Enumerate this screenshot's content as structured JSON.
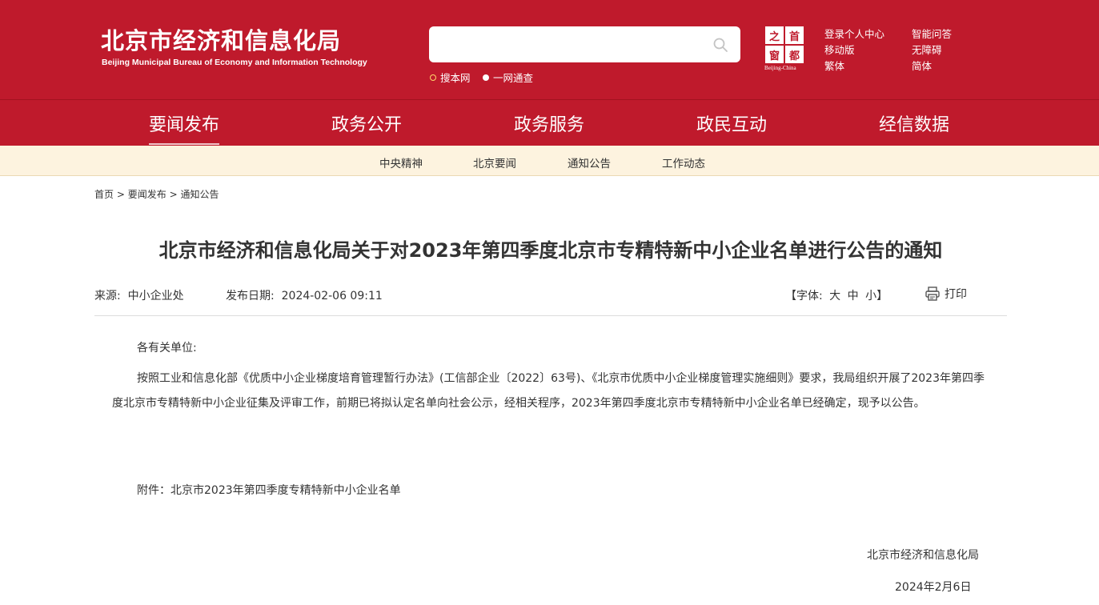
{
  "header": {
    "logo_cn": "北京市经济和信息化局",
    "logo_en": "Beijing Municipal Bureau of Economy and Information Technology",
    "search": {
      "value": "",
      "placeholder": ""
    },
    "scopes": [
      "搜本网",
      "一网通查"
    ],
    "seal_chars": [
      "之",
      "首",
      "窗",
      "都"
    ],
    "seal_en": "Beijing-China",
    "top_links": [
      "登录个人中心",
      "智能问答",
      "移动版",
      "无障碍",
      "繁体",
      "简体"
    ]
  },
  "nav": {
    "main": [
      "要闻发布",
      "政务公开",
      "政务服务",
      "政民互动",
      "经信数据"
    ],
    "active_index": 0,
    "sub": [
      "中央精神",
      "北京要闻",
      "通知公告",
      "工作动态"
    ]
  },
  "breadcrumb": [
    "首页",
    "要闻发布",
    "通知公告"
  ],
  "breadcrumb_sep": ">",
  "article": {
    "title": "北京市经济和信息化局关于对2023年第四季度北京市专精特新中小企业名单进行公告的通知",
    "source_label": "来源:",
    "source": "中小企业处",
    "date_label": "发布日期:",
    "date": "2024-02-06 09:11",
    "font_label": "【字体:",
    "font_sizes": [
      "大",
      "中",
      "小"
    ],
    "font_close": "】",
    "print_label": "打印",
    "greeting": "各有关单位:",
    "paragraph": "按照工业和信息化部《优质中小企业梯度培育管理暂行办法》(工信部企业〔2022〕63号)、《北京市优质中小企业梯度管理实施细则》要求，我局组织开展了2023年第四季度北京市专精特新中小企业征集及评审工作，前期已将拟认定名单向社会公示，经相关程序，2023年第四季度北京市专精特新中小企业名单已经确定，现予以公告。",
    "attachment": "附件：北京市2023年第四季度专精特新中小企业名单",
    "signature_org": "北京市经济和信息化局",
    "signature_date": "2024年2月6日"
  },
  "colors": {
    "header_red": "#bf1a2c",
    "subnav_bg": "#fdf3df",
    "text": "#333333"
  },
  "icons": [
    "search-icon",
    "print-icon",
    "radio-dot-icon"
  ]
}
